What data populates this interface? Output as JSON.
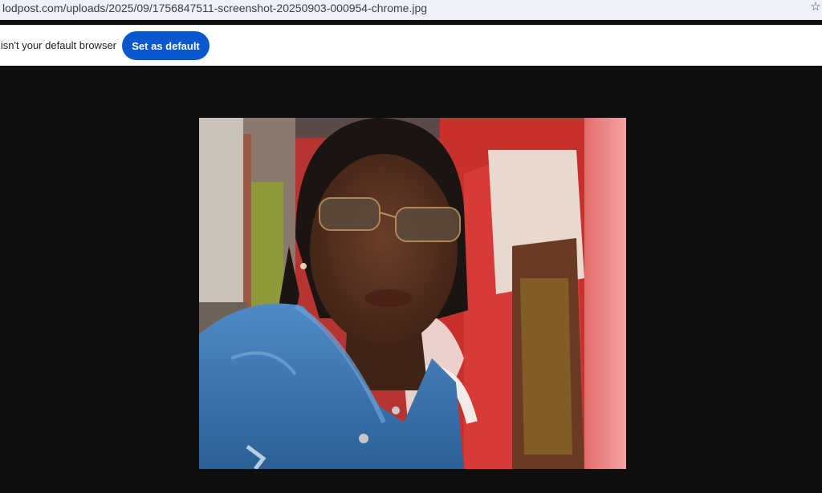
{
  "browser": {
    "url": "lodpost.com/uploads/2025/09/1756847511-screenshot-20250903-000954-chrome.jpg",
    "bookmark_icon": "star-outline-icon"
  },
  "infobar": {
    "message": "Chrome isn't your default browser",
    "button_label": "Set as default"
  },
  "image": {
    "subject": "portrait photo",
    "colors": {
      "background": "#0e0e0f",
      "button": "#0b57d0",
      "banner": "#c8302e",
      "jacket": "#3b78b8"
    }
  }
}
